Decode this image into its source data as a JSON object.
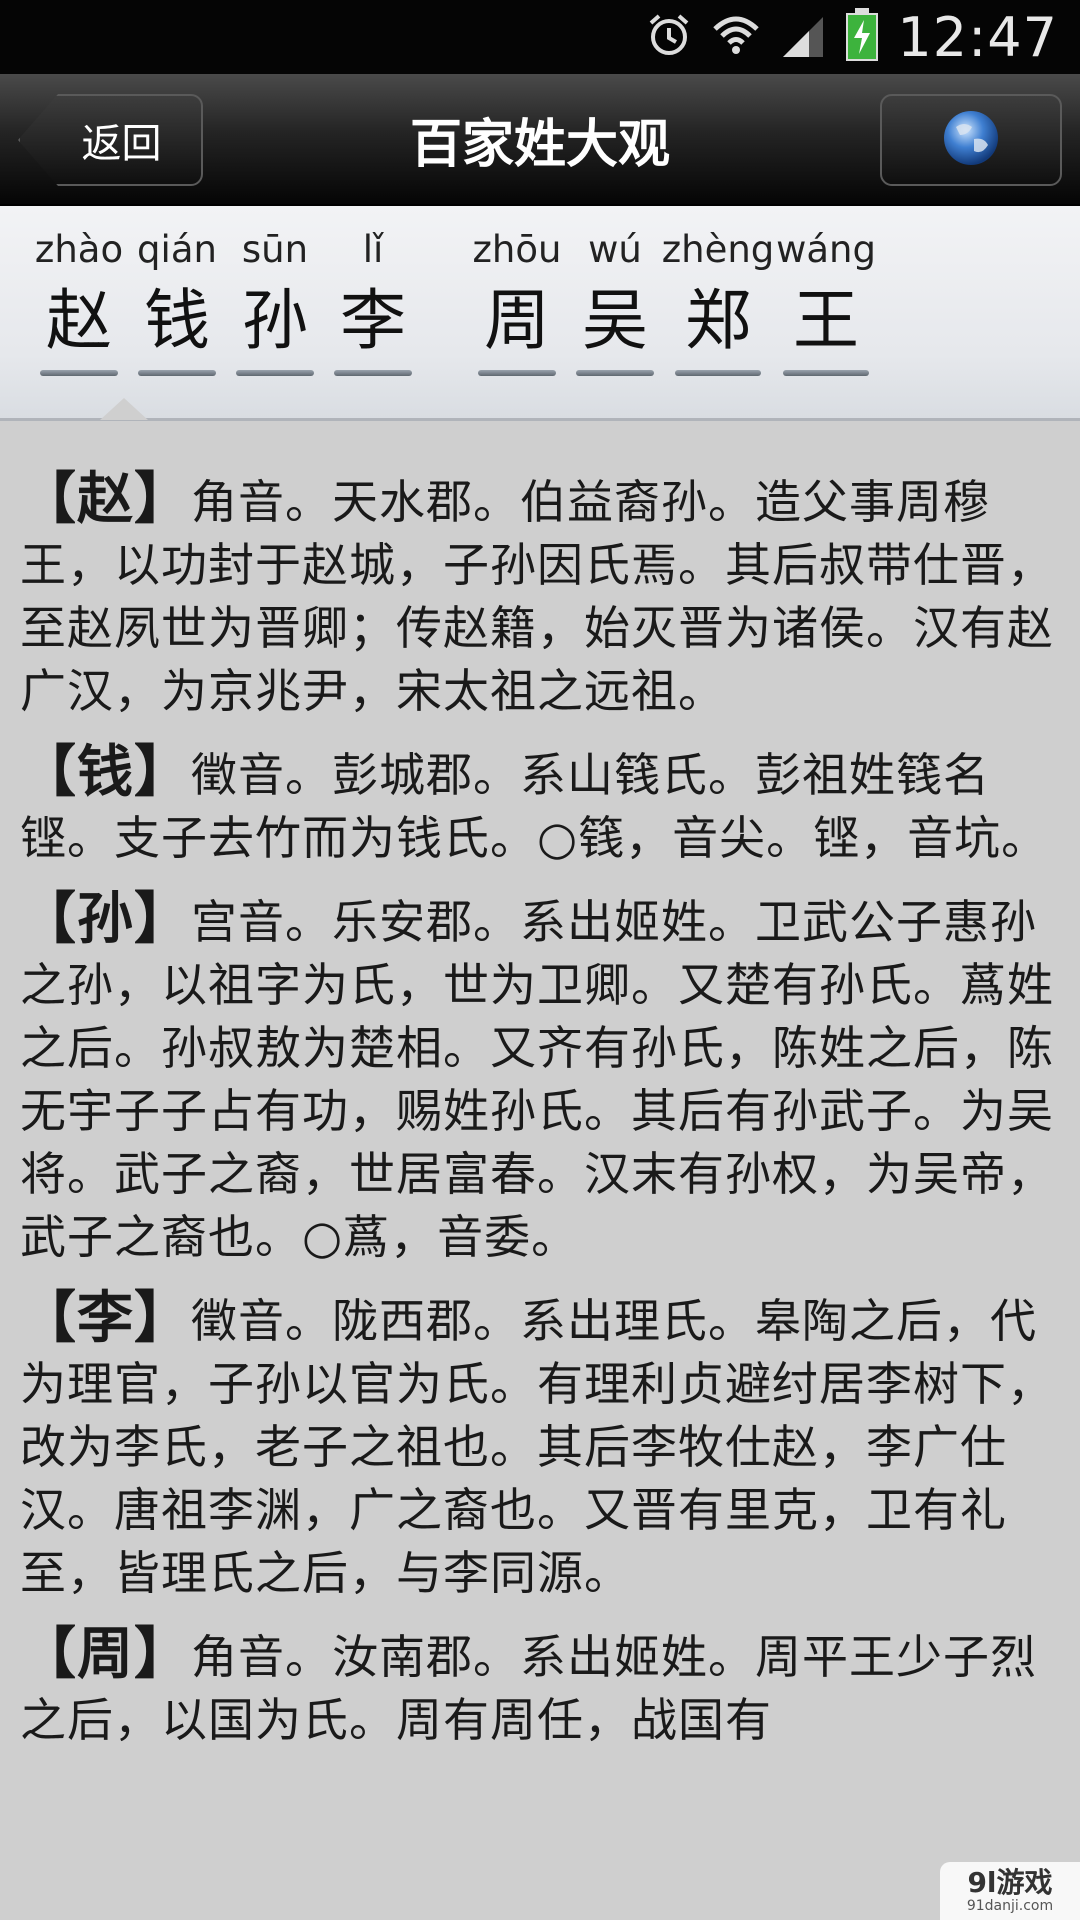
{
  "status_bar": {
    "time": "12:47",
    "icons": [
      "alarm-icon",
      "wifi-icon",
      "signal-icon",
      "battery-charging-icon"
    ]
  },
  "nav": {
    "back_label": "返回",
    "title": "百家姓大观",
    "right_icon": "globe-icon"
  },
  "surnames": [
    {
      "pinyin": "zhào",
      "hanzi": "赵"
    },
    {
      "pinyin": "qián",
      "hanzi": "钱"
    },
    {
      "pinyin": "sūn",
      "hanzi": "孙"
    },
    {
      "pinyin": "lǐ",
      "hanzi": "李"
    },
    {
      "pinyin": "zhōu",
      "hanzi": "周"
    },
    {
      "pinyin": "wú",
      "hanzi": "吴"
    },
    {
      "pinyin": "zhèng",
      "hanzi": "郑"
    },
    {
      "pinyin": "wáng",
      "hanzi": "王"
    }
  ],
  "entries": [
    {
      "head": "【赵】",
      "text": "角音。天水郡。伯益裔孙。造父事周穆王，以功封于赵城，子孙因氏焉。其后叔带仕晋，至赵夙世为晋卿；传赵籍，始灭晋为诸侯。汉有赵广汉，为京兆尹，宋太祖之远祖。"
    },
    {
      "head": "【钱】",
      "text": "徵音。彭城郡。系山篯氏。彭祖姓篯名铿。支子去竹而为钱氏。○篯，音尖。铿，音坑。"
    },
    {
      "head": "【孙】",
      "text": "宫音。乐安郡。系出姬姓。卫武公子惠孙之孙，以祖字为氏，世为卫卿。又楚有孙氏。蔿姓之后。孙叔敖为楚相。又齐有孙氏，陈姓之后，陈无宇子子占有功，赐姓孙氏。其后有孙武子。为吴将。武子之裔，世居富春。汉末有孙权，为吴帝，武子之裔也。○蔿，音委。"
    },
    {
      "head": "【李】",
      "text": "徵音。陇西郡。系出理氏。皋陶之后，代为理官，子孙以官为氏。有理利贞避纣居李树下，改为李氏，老子之祖也。其后李牧仕赵，李广仕汉。唐祖李渊，广之裔也。又晋有里克，卫有礼至，皆理氏之后，与李同源。"
    },
    {
      "head": "【周】",
      "text": "角音。汝南郡。系出姬姓。周平王少子烈之后，以国为氏。周有周任，战国有"
    }
  ],
  "watermark": {
    "main": "9l游戏",
    "sub": "91danji.com"
  }
}
